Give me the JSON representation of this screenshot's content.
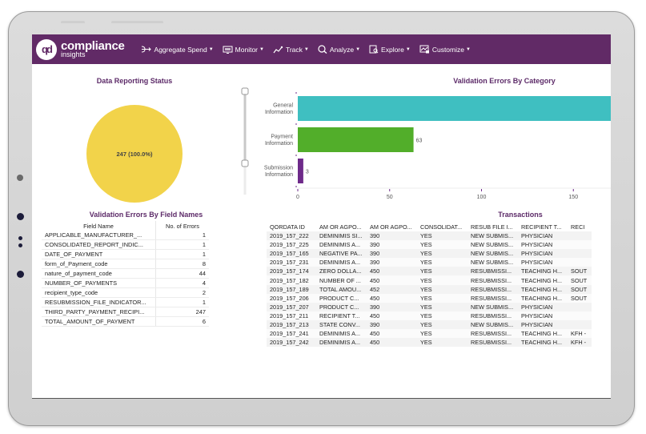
{
  "app": {
    "logo_text": "compliance",
    "logo_subtext": "insights",
    "logo_mark": "qd",
    "brand_color": "#612a66"
  },
  "nav": {
    "items": [
      {
        "label": "Aggregate Spend",
        "icon": "aggregate-icon"
      },
      {
        "label": "Monitor",
        "icon": "monitor-icon"
      },
      {
        "label": "Track",
        "icon": "track-icon"
      },
      {
        "label": "Analyze",
        "icon": "analyze-icon"
      },
      {
        "label": "Explore",
        "icon": "explore-icon"
      },
      {
        "label": "Customize",
        "icon": "customize-icon"
      }
    ]
  },
  "panels": {
    "reporting_status_title": "Data Reporting Status",
    "category_title": "Validation Errors By Category",
    "field_names_title": "Validation Errors By Field Names",
    "transactions_title": "Transactions"
  },
  "chart_data": [
    {
      "type": "pie",
      "title": "Data Reporting Status",
      "slices": [
        {
          "label": "",
          "value": 247,
          "percent": 100.0,
          "color": "#f2d34a"
        }
      ],
      "data_label": "247 (100.0%)"
    },
    {
      "type": "bar",
      "orientation": "horizontal",
      "title": "Validation Errors By Category",
      "categories": [
        "General Information",
        "Payment Information",
        "Submission Information"
      ],
      "category_lines": [
        [
          "General",
          "Information"
        ],
        [
          "Payment",
          "Information"
        ],
        [
          "Submission",
          "Information"
        ]
      ],
      "values": [
        181,
        63,
        3
      ],
      "data_labels": [
        "",
        "63",
        "3"
      ],
      "colors": [
        "#3fbfc1",
        "#52ae2a",
        "#6e2a8a"
      ],
      "xticks": [
        0,
        50,
        100,
        150
      ],
      "xlim_visible": [
        0,
        171
      ],
      "note": "General Information bar extends beyond visible area; value estimated"
    }
  ],
  "field_errors": {
    "headers": [
      "Field Name",
      "No. of Errors"
    ],
    "rows": [
      [
        "APPLICABLE_MANUFACTURER_...",
        "1"
      ],
      [
        "CONSOLIDATED_REPORT_INDIC...",
        "1"
      ],
      [
        "DATE_OF_PAYMENT",
        "1"
      ],
      [
        "form_of_Payment_code",
        "8"
      ],
      [
        "nature_of_payment_code",
        "44"
      ],
      [
        "NUMBER_OF_PAYMENTS",
        "4"
      ],
      [
        "recipient_type_code",
        "2"
      ],
      [
        "RESUBMISSION_FILE_INDICATOR...",
        "1"
      ],
      [
        "THIRD_PARTY_PAYMENT_RECIPI...",
        "247"
      ],
      [
        "TOTAL_AMOUNT_OF_PAYMENT",
        "6"
      ]
    ]
  },
  "transactions": {
    "headers": [
      "QORDATA ID",
      "AM OR AGPO...",
      "AM OR AGPO...",
      "CONSOLIDAT...",
      "RESUB FILE I...",
      "RECIPIENT T...",
      "RECI"
    ],
    "rows": [
      [
        "2019_157_222",
        "DEMINIMIS SI...",
        "390",
        "YES",
        "NEW SUBMIS...",
        "PHYSICIAN",
        ""
      ],
      [
        "2019_157_225",
        "DEMINIMIS A...",
        "390",
        "YES",
        "NEW SUBMIS...",
        "PHYSICIAN",
        ""
      ],
      [
        "2019_157_165",
        "NEGATIVE PA...",
        "390",
        "YES",
        "NEW SUBMIS...",
        "PHYSICIAN",
        ""
      ],
      [
        "2019_157_231",
        "DEMINIMIS A...",
        "390",
        "YES",
        "NEW SUBMIS...",
        "PHYSICIAN",
        ""
      ],
      [
        "2019_157_174",
        "ZERO DOLLA...",
        "450",
        "YES",
        "RESUBMISSI...",
        "TEACHING H...",
        "SOUT"
      ],
      [
        "2019_157_182",
        "NUMBER OF ...",
        "450",
        "YES",
        "RESUBMISSI...",
        "TEACHING H...",
        "SOUT"
      ],
      [
        "2019_157_189",
        "TOTAL AMOU...",
        "452",
        "YES",
        "RESUBMISSI...",
        "TEACHING H...",
        "SOUT"
      ],
      [
        "2019_157_206",
        "PRODUCT C...",
        "450",
        "YES",
        "RESUBMISSI...",
        "TEACHING H...",
        "SOUT"
      ],
      [
        "2019_157_207",
        "PRODUCT C...",
        "390",
        "YES",
        "NEW SUBMIS...",
        "PHYSICIAN",
        ""
      ],
      [
        "2019_157_211",
        "RECIPIENT T...",
        "450",
        "YES",
        "RESUBMISSI...",
        "PHYSICIAN",
        ""
      ],
      [
        "2019_157_213",
        "STATE CONV...",
        "390",
        "YES",
        "NEW SUBMIS...",
        "PHYSICIAN",
        ""
      ],
      [
        "2019_157_241",
        "DEMINIMIS A...",
        "450",
        "YES",
        "RESUBMISSI...",
        "TEACHING H...",
        "KFH -"
      ],
      [
        "2019_157_242",
        "DEMINIMIS A...",
        "450",
        "YES",
        "RESUBMISSI...",
        "TEACHING H...",
        "KFH -"
      ]
    ]
  }
}
